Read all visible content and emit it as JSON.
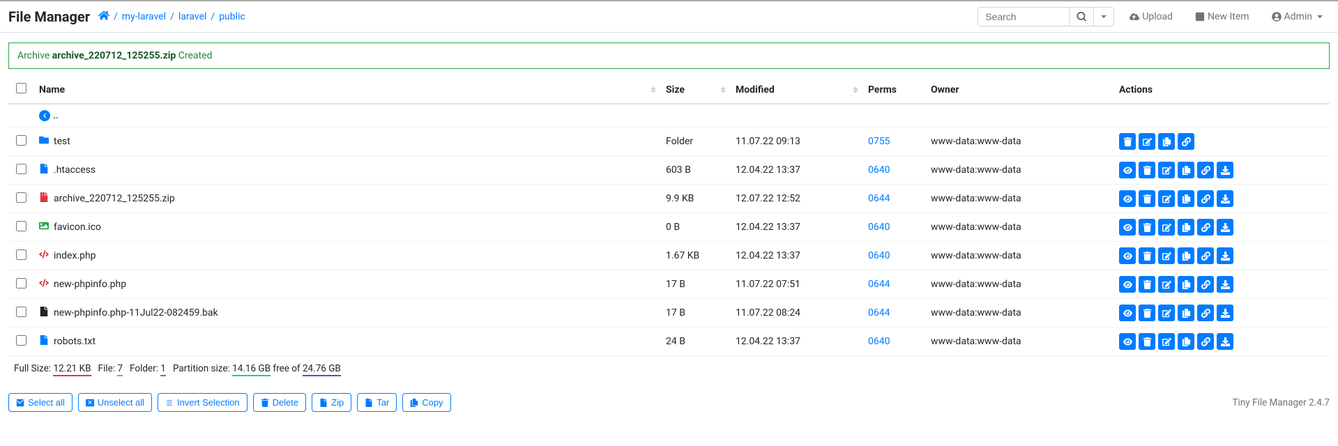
{
  "header": {
    "brand": "File Manager",
    "search_placeholder": "Search",
    "upload_label": "Upload",
    "newitem_label": "New Item",
    "admin_label": "Admin"
  },
  "breadcrumbs": [
    "my-laravel",
    "laravel",
    "public"
  ],
  "alert": {
    "prefix": "Archive",
    "filename": "archive_220712_125255.zip",
    "suffix": "Created"
  },
  "columns": {
    "name": "Name",
    "size": "Size",
    "modified": "Modified",
    "perms": "Perms",
    "owner": "Owner",
    "actions": "Actions"
  },
  "back_label": "..",
  "rows": [
    {
      "icon": "folder",
      "name": "test",
      "size": "Folder",
      "modified": "11.07.22 09:13",
      "perms": "0755",
      "owner": "www-data:www-data",
      "is_folder": true
    },
    {
      "icon": "file",
      "name": ".htaccess",
      "size": "603 B",
      "modified": "12.04.22 13:37",
      "perms": "0640",
      "owner": "www-data:www-data",
      "is_folder": false
    },
    {
      "icon": "archive",
      "name": "archive_220712_125255.zip",
      "size": "9.9 KB",
      "modified": "12.07.22 12:52",
      "perms": "0644",
      "owner": "www-data:www-data",
      "is_folder": false
    },
    {
      "icon": "image",
      "name": "favicon.ico",
      "size": "0 B",
      "modified": "12.04.22 13:37",
      "perms": "0640",
      "owner": "www-data:www-data",
      "is_folder": false
    },
    {
      "icon": "code",
      "name": "index.php",
      "size": "1.67 KB",
      "modified": "12.04.22 13:37",
      "perms": "0640",
      "owner": "www-data:www-data",
      "is_folder": false
    },
    {
      "icon": "code",
      "name": "new-phpinfo.php",
      "size": "17 B",
      "modified": "11.07.22 07:51",
      "perms": "0644",
      "owner": "www-data:www-data",
      "is_folder": false
    },
    {
      "icon": "filedark",
      "name": "new-phpinfo.php-11Jul22-082459.bak",
      "size": "17 B",
      "modified": "11.07.22 08:24",
      "perms": "0644",
      "owner": "www-data:www-data",
      "is_folder": false
    },
    {
      "icon": "file",
      "name": "robots.txt",
      "size": "24 B",
      "modified": "12.04.22 13:37",
      "perms": "0640",
      "owner": "www-data:www-data",
      "is_folder": false
    }
  ],
  "stats": {
    "fullsize_label": "Full Size:",
    "fullsize": "12.21 KB",
    "file_label": "File:",
    "file_count": "7",
    "folder_label": "Folder:",
    "folder_count": "1",
    "partition_label": "Partition size:",
    "partition_free": "14.16 GB",
    "free_of": "free of",
    "partition_total": "24.76 GB"
  },
  "buttons": {
    "select_all": "Select all",
    "unselect_all": "Unselect all",
    "invert": "Invert Selection",
    "delete": "Delete",
    "zip": "Zip",
    "tar": "Tar",
    "copy": "Copy"
  },
  "version": "Tiny File Manager 2.4.7"
}
